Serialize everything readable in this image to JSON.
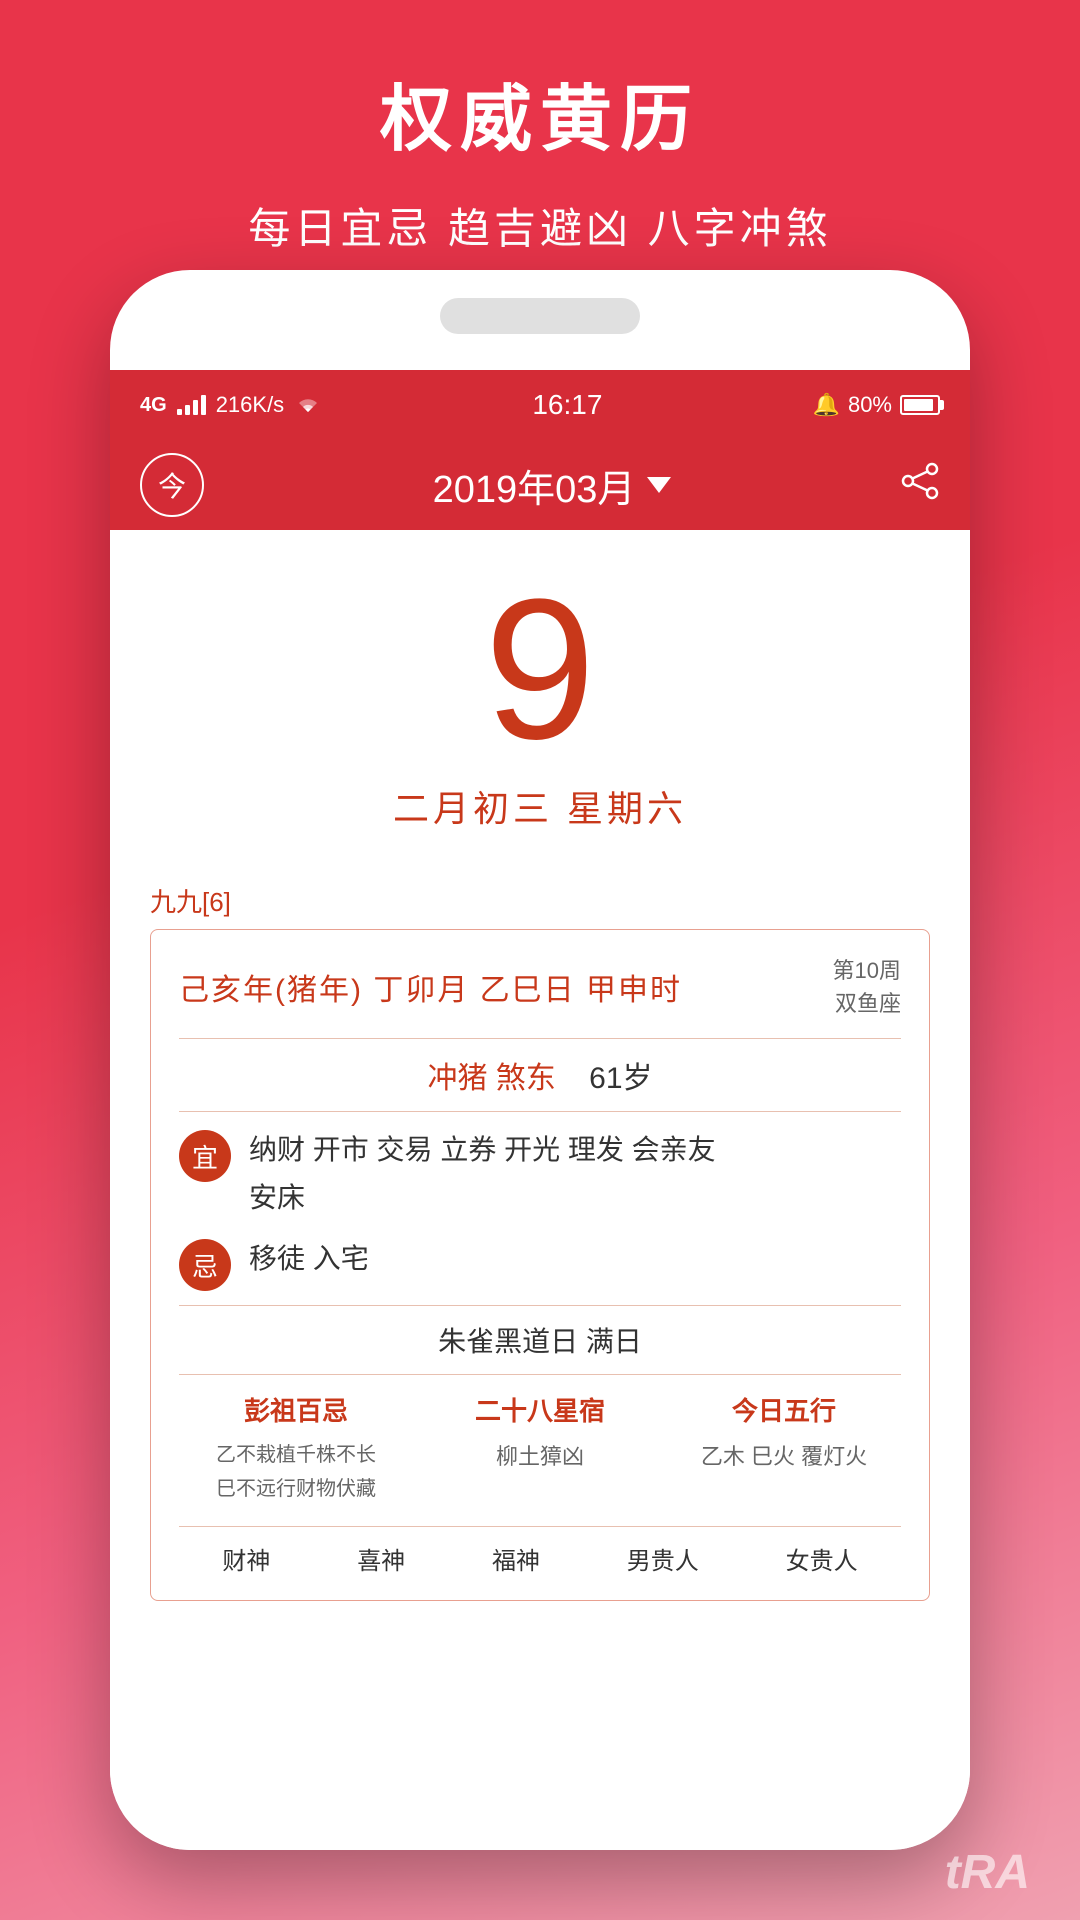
{
  "app": {
    "title": "权威黄历",
    "subtitle": "每日宜忌 趋吉避凶 八字冲煞"
  },
  "status_bar": {
    "network": "4G",
    "speed": "216K/s",
    "time": "16:17",
    "alarm": "🔔",
    "battery": "80%"
  },
  "nav_bar": {
    "today_label": "今",
    "month_display": "2019年03月",
    "has_dropdown": true
  },
  "main": {
    "day_number": "9",
    "lunar_date": "二月初三  星期六",
    "nine_nine_label": "九九[6]",
    "ganzhi": {
      "main": "己亥年(猪年)  丁卯月  乙巳日  甲申时",
      "week": "第10周",
      "zodiac": "双鱼座"
    },
    "chong": {
      "text": "冲猪  煞东",
      "age": "61岁"
    },
    "yi": {
      "label": "宜",
      "content": "纳财 开市 交易 立券 开光 理发 会亲友\n安床"
    },
    "ji": {
      "label": "忌",
      "content": "移徒 入宅"
    },
    "black_day": "朱雀黑道日  满日",
    "three_cols": {
      "col1": {
        "title": "彭祖百忌",
        "content": "乙不栽植千株不长\n巳不远行财物伏藏"
      },
      "col2": {
        "title": "二十八星宿",
        "content": "柳土獐凶"
      },
      "col3": {
        "title": "今日五行",
        "content": "乙木 巳火 覆灯火"
      }
    },
    "bottom_gods": [
      "财神",
      "喜神",
      "福神",
      "男贵人",
      "女贵人"
    ]
  },
  "watermark": "tRA"
}
